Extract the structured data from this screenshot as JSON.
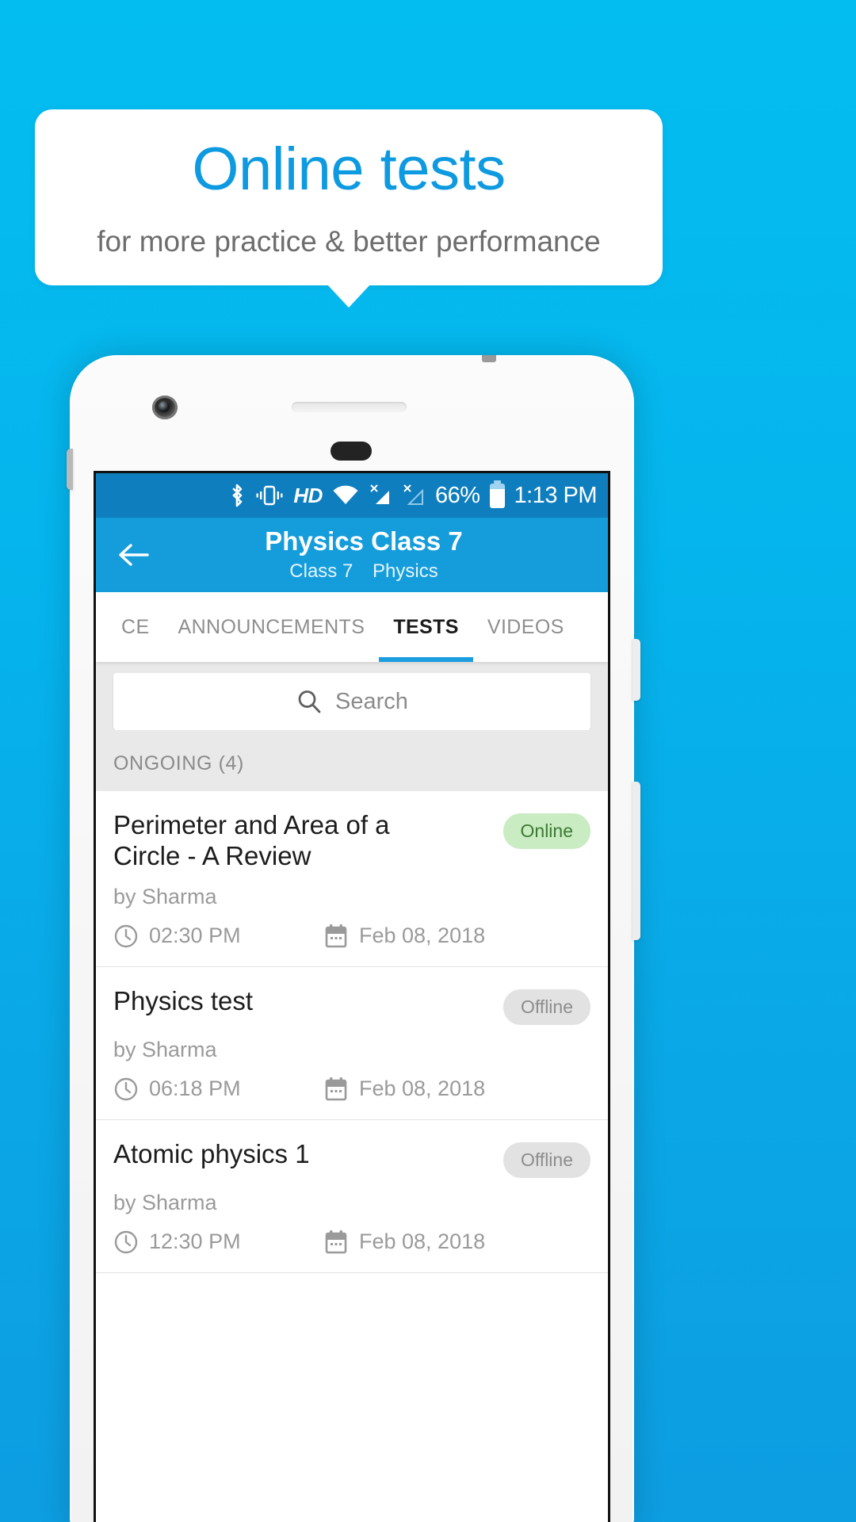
{
  "promo": {
    "headline": "Online tests",
    "subheadline": "for more practice & better performance",
    "accent_color": "#0e9ae0",
    "background_color": "#05b5ed"
  },
  "status_bar": {
    "bluetooth_icon": "bluetooth-icon",
    "vibrate_icon": "vibrate-icon",
    "hd_label": "HD",
    "wifi_icon": "wifi-icon",
    "signal1_icon": "signal-no-sim-icon",
    "signal2_icon": "signal-no-service-icon",
    "battery_percent": "66%",
    "battery_icon": "battery-icon",
    "time": "1:13 PM",
    "background_color": "#0f7ebf"
  },
  "app_bar": {
    "back_icon": "back-arrow-icon",
    "title": "Physics Class 7",
    "subtitle_class": "Class 7",
    "subtitle_subject": "Physics",
    "background_color": "#159ddb"
  },
  "tabs": {
    "items": [
      {
        "label": "CE",
        "active": false
      },
      {
        "label": "ANNOUNCEMENTS",
        "active": false
      },
      {
        "label": "TESTS",
        "active": true
      },
      {
        "label": "VIDEOS",
        "active": false
      }
    ],
    "indicator_color": "#1b9ee0"
  },
  "search": {
    "icon": "search-icon",
    "placeholder": "Search",
    "value": ""
  },
  "section": {
    "ongoing_header": "ONGOING (4)"
  },
  "tests": [
    {
      "title": "Perimeter and Area of a Circle - A Review",
      "author": "by Sharma",
      "badge": "Online",
      "badge_state": "online",
      "time": "02:30 PM",
      "date": "Feb 08, 2018",
      "time_icon": "clock-icon",
      "date_icon": "calendar-icon"
    },
    {
      "title": "Physics test",
      "author": "by Sharma",
      "badge": "Offline",
      "badge_state": "offline",
      "time": "06:18 PM",
      "date": "Feb 08, 2018",
      "time_icon": "clock-icon",
      "date_icon": "calendar-icon"
    },
    {
      "title": "Atomic physics 1",
      "author": "by Sharma",
      "badge": "Offline",
      "badge_state": "offline",
      "time": "12:30 PM",
      "date": "Feb 08, 2018",
      "time_icon": "clock-icon",
      "date_icon": "calendar-icon"
    }
  ]
}
